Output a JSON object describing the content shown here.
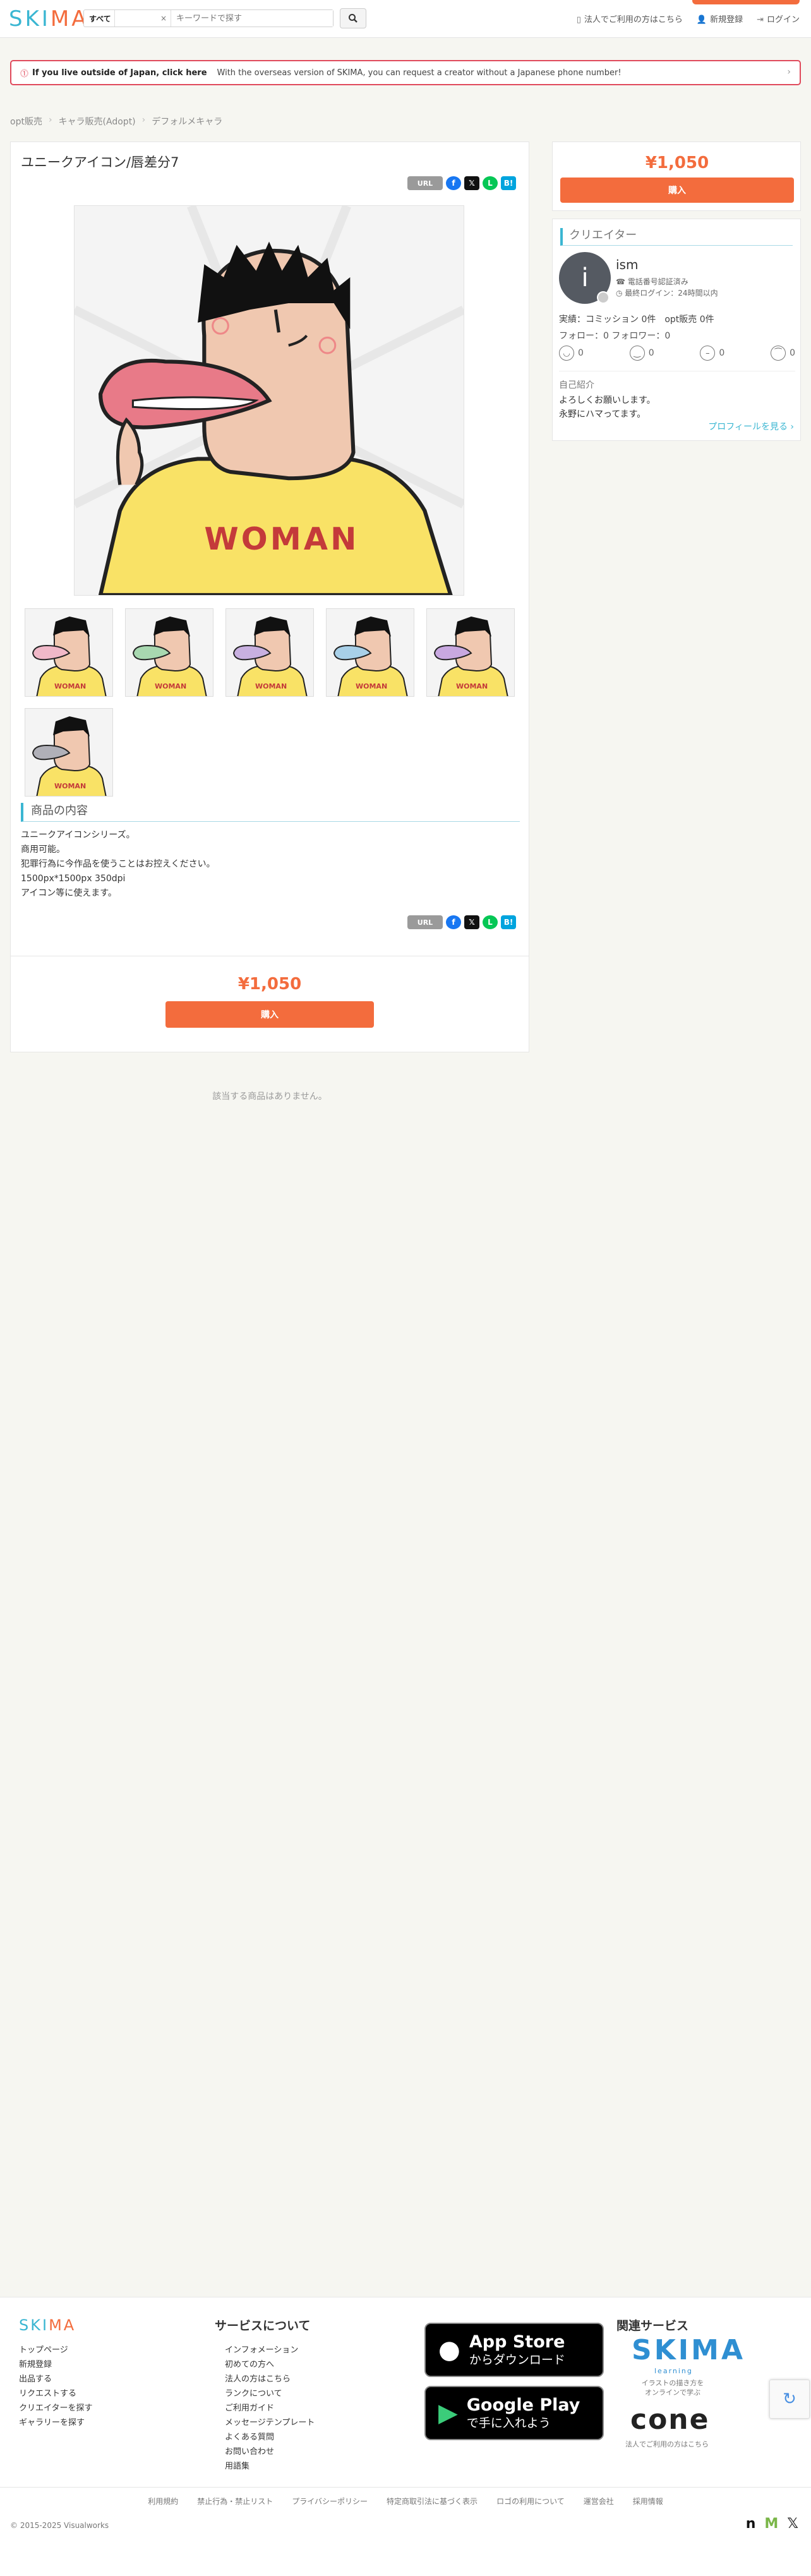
{
  "header": {
    "logo_a": "SKI",
    "logo_b": "MA",
    "search_category": "すべて",
    "search_select": "×",
    "search_placeholder": "キーワードで探す",
    "links": [
      "法人でご利用の方はこちら",
      "新規登録",
      "ログイン"
    ]
  },
  "notice": {
    "bold": "If you live outside of Japan, click here",
    "text": "With the overseas version of SKIMA, you can request a creator without a Japanese phone number!",
    "chevron": "›"
  },
  "breadcrumb": [
    "opt販売",
    "キャラ販売(Adopt)",
    "デフォルメキャラ"
  ],
  "product": {
    "title": "ユニークアイコン/唇差分7",
    "share": {
      "url": "URL",
      "fb": "f",
      "x": "𝕏",
      "line": "L",
      "hatena": "B!"
    },
    "section_title": "商品の内容",
    "description": [
      "ユニークアイコンシリーズ。",
      "商用可能。",
      "犯罪行為に今作品を使うことはお控えください。",
      "1500px*1500px 350dpi",
      "アイコン等に使えます。"
    ],
    "shirt_text": "WOMAN",
    "price": "¥1,050",
    "buy_label": "購入",
    "lip_colors": [
      "#f0b8c8",
      "#f0b8c8",
      "#a8d8b0",
      "#c8b0e0",
      "#a8d0e8",
      "#c8a8e0",
      "#b0b0b8"
    ]
  },
  "no_items": "該当する商品はありません。",
  "creator": {
    "heading": "クリエイター",
    "avatar_letter": "i",
    "name": "ism",
    "verified": "電話番号認証済み",
    "last_login": "最終ログイン：24時間以内",
    "stats": "実績：コミッション 0件　opt販売 0件",
    "follow": "フォロー：0 フォロワー：0",
    "faces": [
      "0",
      "0",
      "0",
      "0"
    ],
    "intro_heading": "自己紹介",
    "intro": [
      "よろしくお願いします。",
      "永野にハマってます。"
    ],
    "profile_link": "プロフィールを見る ›"
  },
  "footer": {
    "logo_a": "SKI",
    "logo_b": "MA",
    "col1": [
      "トップページ",
      "新規登録",
      "出品する",
      "リクエストする",
      "クリエイターを探す",
      "ギャラリーを探す"
    ],
    "services_heading": "サービスについて",
    "col2": [
      "インフォメーション",
      "初めての方へ",
      "法人の方はこちら",
      "ランクについて",
      "ご利用ガイド",
      "メッセージテンプレート",
      "よくある質問",
      "お問い合わせ",
      "用語集"
    ],
    "appstore_big": "App Store",
    "appstore_small": "からダウンロード",
    "gplay_big": "Google Play",
    "gplay_small": "で手に入れよう",
    "related_heading": "関連サービス",
    "rel_skima": "SKIMA",
    "rel_learning": "learning",
    "rel_skima_text": "イラストの描き方を\nオンラインで学ぶ",
    "rel_cone": "cone",
    "rel_cone_text": "法人でご利用の方はこちら",
    "links": [
      "利用規約",
      "禁止行為・禁止リスト",
      "プライバシーポリシー",
      "特定商取引法に基づく表示",
      "ロゴの利用について",
      "運営会社",
      "採用情報"
    ],
    "copyright": "© 2015-2025 Visualworks"
  }
}
